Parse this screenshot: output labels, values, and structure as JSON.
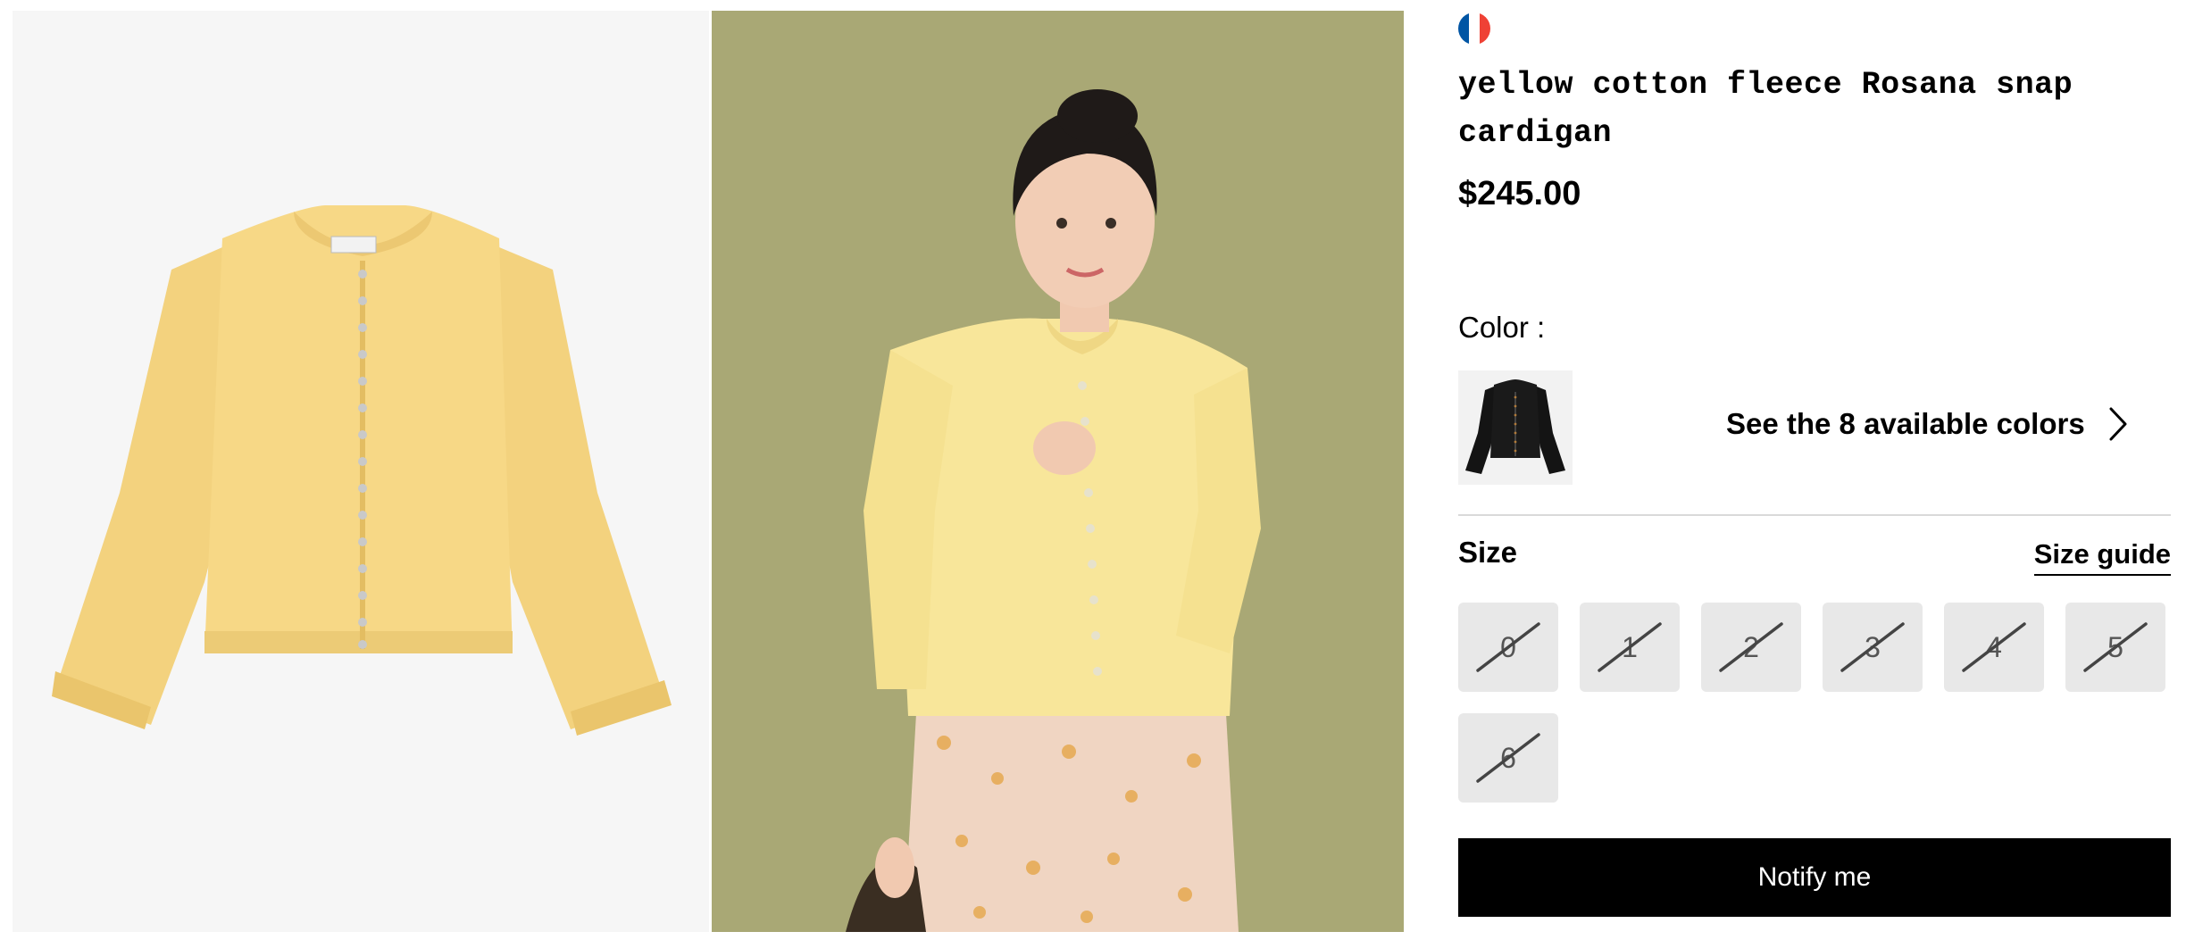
{
  "product": {
    "title": "yellow cotton fleece Rosana snap cardigan",
    "price": "$245.00",
    "flag_colors": [
      "#0055a4",
      "#ffffff",
      "#ef4135"
    ]
  },
  "color": {
    "label": "Color :",
    "swatch_name": "black cardigan swatch",
    "link_text": "See the 8 available colors",
    "link_icon": "chevron-right-icon"
  },
  "size": {
    "label": "Size",
    "guide_label": "Size guide",
    "options": [
      {
        "label": "0",
        "available": false
      },
      {
        "label": "1",
        "available": false
      },
      {
        "label": "2",
        "available": false
      },
      {
        "label": "3",
        "available": false
      },
      {
        "label": "4",
        "available": false
      },
      {
        "label": "5",
        "available": false
      },
      {
        "label": "6",
        "available": false
      }
    ]
  },
  "actions": {
    "notify_label": "Notify me"
  },
  "colors": {
    "product_yellow": "#f6d98a",
    "model_background": "#a9a875",
    "flat_background": "#f6f6f6",
    "size_unavailable_bg": "#e8e8e8",
    "button_bg": "#000000"
  }
}
